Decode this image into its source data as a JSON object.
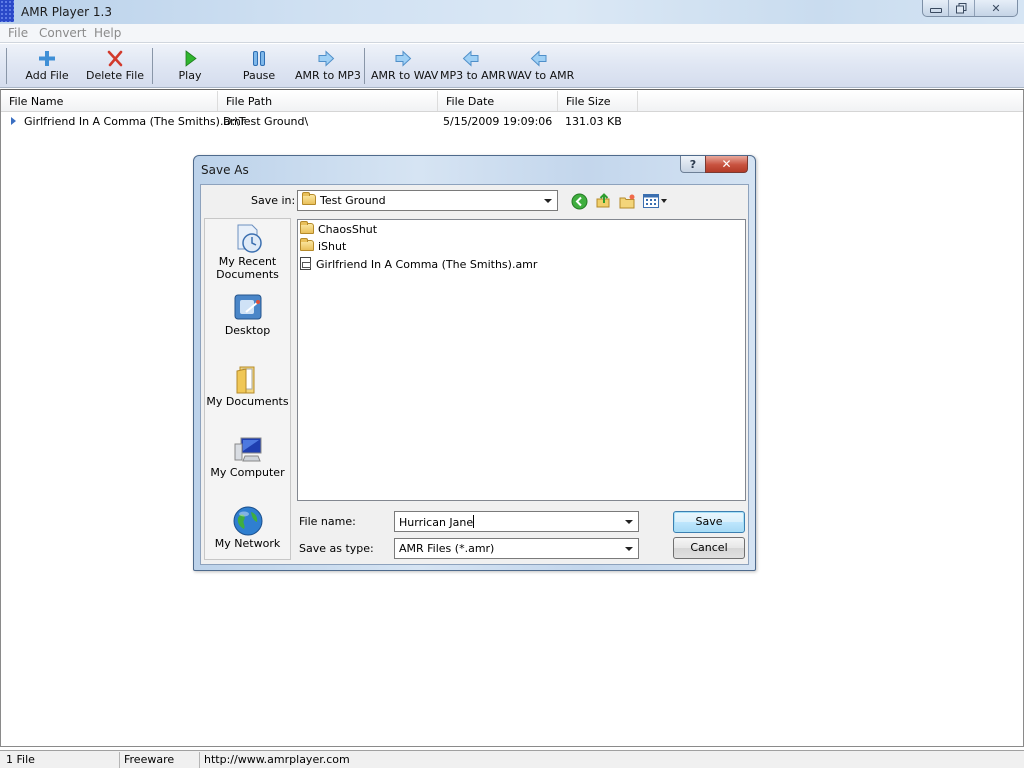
{
  "window": {
    "title": "AMR Player 1.3",
    "controls": {
      "minimize": "minimize",
      "maximize": "restore",
      "close": "✕"
    }
  },
  "menu": [
    "File",
    "Convert",
    "Help"
  ],
  "toolbar": {
    "buttons": [
      {
        "label": "Add File",
        "icon": "plus-icon"
      },
      {
        "label": "Delete File",
        "icon": "delete-x-icon"
      },
      {
        "label": "Play",
        "icon": "play-icon"
      },
      {
        "label": "Pause",
        "icon": "pause-icon"
      },
      {
        "label": "AMR to MP3",
        "icon": "arrow-right-icon"
      },
      {
        "label": "AMR to WAV",
        "icon": "arrow-right-icon"
      },
      {
        "label": "MP3 to AMR",
        "icon": "arrow-left-icon"
      },
      {
        "label": "WAV to AMR",
        "icon": "arrow-left-icon"
      }
    ]
  },
  "filelist": {
    "columns": [
      "File Name",
      "File Path",
      "File Date",
      "File Size"
    ],
    "rows": [
      {
        "name": "Girlfriend In A Comma (The Smiths).amr",
        "path": "D:\\Test Ground\\",
        "date": "5/15/2009 19:09:06",
        "size": "131.03 KB"
      }
    ]
  },
  "statusbar": {
    "count": "1 File",
    "license": "Freeware",
    "url": "http://www.amrplayer.com"
  },
  "dialog": {
    "title": "Save As",
    "help": "?",
    "close": "✕",
    "save_in_label": "Save in:",
    "save_in_value": "Test Ground",
    "places": [
      {
        "label": "My Recent Documents",
        "icon": "recent-documents-icon"
      },
      {
        "label": "Desktop",
        "icon": "desktop-icon"
      },
      {
        "label": "My Documents",
        "icon": "my-documents-icon"
      },
      {
        "label": "My Computer",
        "icon": "my-computer-icon"
      },
      {
        "label": "My Network",
        "icon": "my-network-icon"
      }
    ],
    "items": [
      {
        "name": "ChaosShut",
        "type": "folder"
      },
      {
        "name": "iShut",
        "type": "folder"
      },
      {
        "name": "Girlfriend In A Comma (The Smiths).amr",
        "type": "amr-file"
      }
    ],
    "file_name_label": "File name:",
    "file_name_value": "Hurrican Jane",
    "save_type_label": "Save as type:",
    "save_type_value": "AMR Files (*.amr)",
    "save_button": "Save",
    "cancel_button": "Cancel"
  }
}
